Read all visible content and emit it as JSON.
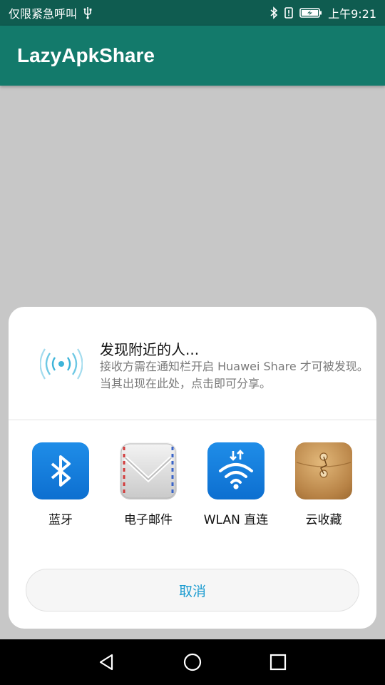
{
  "status_bar": {
    "left_text": "仅限紧急呼叫",
    "time": "上午9:21",
    "icons": [
      "usb-icon",
      "bluetooth-icon",
      "vibrate-icon",
      "battery-charging-icon"
    ]
  },
  "app_bar": {
    "title": "LazyApkShare"
  },
  "share_sheet": {
    "nearby": {
      "title": "发现附近的人...",
      "description": "接收方需在通知栏开启 Huawei Share 才可被发现。当其出现在此处，点击即可分享。",
      "icon": "nearby-wireless-icon"
    },
    "targets": [
      {
        "label": "蓝牙",
        "icon": "bluetooth-icon",
        "color": "#1580df"
      },
      {
        "label": "电子邮件",
        "icon": "email-icon",
        "color": "#d9d9d9"
      },
      {
        "label": "WLAN 直连",
        "icon": "wifi-direct-icon",
        "color": "#1580df"
      },
      {
        "label": "云收藏",
        "icon": "cloud-favorites-icon",
        "color": "#c08d4e"
      }
    ],
    "cancel_label": "取消"
  },
  "nav_bar": {
    "buttons": [
      "back-icon",
      "home-icon",
      "recents-icon"
    ]
  },
  "colors": {
    "status_bar": "#0f5c50",
    "app_bar": "#137a6b",
    "scrim": "#c7c7c7",
    "cancel_text": "#1a9bd0"
  }
}
